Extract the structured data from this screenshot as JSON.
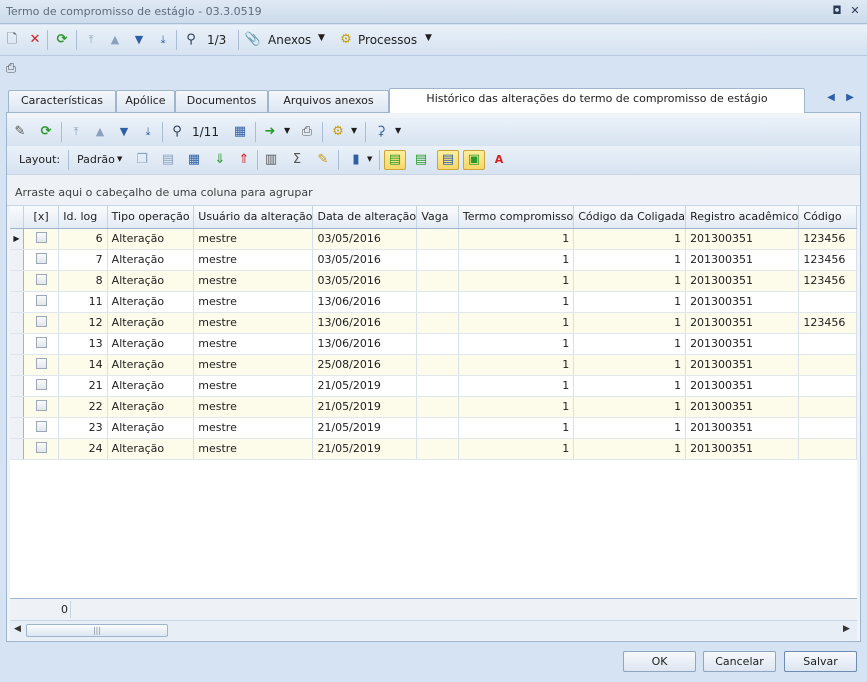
{
  "window": {
    "title": "Termo de compromisso de estágio - 03.3.0519"
  },
  "toolbar": {
    "record_counter": "1/3",
    "attachments_label": "Anexos",
    "processes_label": "Processos"
  },
  "tabs": [
    {
      "label": "Características"
    },
    {
      "label": "Apólice"
    },
    {
      "label": "Documentos"
    },
    {
      "label": "Arquivos anexos"
    },
    {
      "label": "Histórico das alterações do termo de compromisso de estágio"
    }
  ],
  "grid_toolbar": {
    "record_counter": "1/11",
    "layout_label": "Layout:",
    "layout_value": "Padrão"
  },
  "group_panel": {
    "text": "Arraste aqui o cabeçalho de uma coluna para agrupar"
  },
  "columns": [
    "[x]",
    "Id. log",
    "Tipo operação",
    "Usuário da alteração",
    "Data de alteração",
    "Vaga",
    "Termo compromisso",
    "Código da Coligada",
    "Registro acadêmico",
    "Código"
  ],
  "rows": [
    {
      "id": "6",
      "tipo": "Alteração",
      "usuario": "mestre",
      "data": "03/05/2016",
      "vaga": "",
      "termo": "1",
      "coligada": "1",
      "ra": "201300351",
      "codigo": "123456"
    },
    {
      "id": "7",
      "tipo": "Alteração",
      "usuario": "mestre",
      "data": "03/05/2016",
      "vaga": "",
      "termo": "1",
      "coligada": "1",
      "ra": "201300351",
      "codigo": "123456"
    },
    {
      "id": "8",
      "tipo": "Alteração",
      "usuario": "mestre",
      "data": "03/05/2016",
      "vaga": "",
      "termo": "1",
      "coligada": "1",
      "ra": "201300351",
      "codigo": "123456"
    },
    {
      "id": "11",
      "tipo": "Alteração",
      "usuario": "mestre",
      "data": "13/06/2016",
      "vaga": "",
      "termo": "1",
      "coligada": "1",
      "ra": "201300351",
      "codigo": ""
    },
    {
      "id": "12",
      "tipo": "Alteração",
      "usuario": "mestre",
      "data": "13/06/2016",
      "vaga": "",
      "termo": "1",
      "coligada": "1",
      "ra": "201300351",
      "codigo": "123456"
    },
    {
      "id": "13",
      "tipo": "Alteração",
      "usuario": "mestre",
      "data": "13/06/2016",
      "vaga": "",
      "termo": "1",
      "coligada": "1",
      "ra": "201300351",
      "codigo": ""
    },
    {
      "id": "14",
      "tipo": "Alteração",
      "usuario": "mestre",
      "data": "25/08/2016",
      "vaga": "",
      "termo": "1",
      "coligada": "1",
      "ra": "201300351",
      "codigo": ""
    },
    {
      "id": "21",
      "tipo": "Alteração",
      "usuario": "mestre",
      "data": "21/05/2019",
      "vaga": "",
      "termo": "1",
      "coligada": "1",
      "ra": "201300351",
      "codigo": ""
    },
    {
      "id": "22",
      "tipo": "Alteração",
      "usuario": "mestre",
      "data": "21/05/2019",
      "vaga": "",
      "termo": "1",
      "coligada": "1",
      "ra": "201300351",
      "codigo": ""
    },
    {
      "id": "23",
      "tipo": "Alteração",
      "usuario": "mestre",
      "data": "21/05/2019",
      "vaga": "",
      "termo": "1",
      "coligada": "1",
      "ra": "201300351",
      "codigo": ""
    },
    {
      "id": "24",
      "tipo": "Alteração",
      "usuario": "mestre",
      "data": "21/05/2019",
      "vaga": "",
      "termo": "1",
      "coligada": "1",
      "ra": "201300351",
      "codigo": ""
    }
  ],
  "footer": {
    "count": "0"
  },
  "buttons": {
    "ok": "OK",
    "cancel": "Cancelar",
    "save": "Salvar"
  }
}
